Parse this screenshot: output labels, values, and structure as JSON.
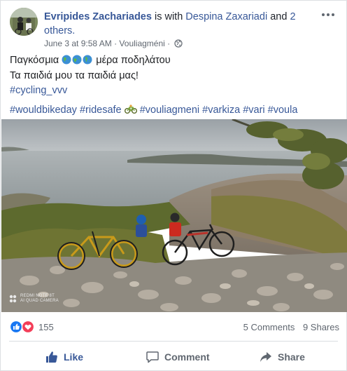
{
  "post": {
    "author": "Evripides Zachariades",
    "with_text": "is with",
    "tagged_person": "Despina Zaxariadi",
    "and_text": "and",
    "others": "2 others.",
    "date": "June 3 at 9:58 AM",
    "separator": "·",
    "location": "Vouliagméni",
    "separator2": "·",
    "privacy_icon": "globe-icon",
    "more_icon": "more-options-icon"
  },
  "text": {
    "line1_start": "Παγκόσμια",
    "line1_emoji": "globe-emoji x3",
    "line1_end": "μέρα ποδηλάτου",
    "line2": "Τα παιδιά μου τα παιδιά μας!",
    "line3": "#cycling_vvv",
    "tag1": "#wouldbikeday",
    "tag2": "#ridesafe",
    "bike_emoji": "bicycle-emoji",
    "tag3": "#vouliagmeni",
    "tag4": "#varkiza",
    "tag5": "#vari",
    "tag6": "#voula"
  },
  "photo": {
    "watermark_line1": "REDMI NOTE 8T",
    "watermark_line2": "AI QUAD CAMERA"
  },
  "reactions": {
    "icons": [
      "like-reaction-icon",
      "love-reaction-icon"
    ],
    "count": "155",
    "comments": "5 Comments",
    "shares": "9 Shares"
  },
  "actions": {
    "like": "Like",
    "comment": "Comment",
    "share": "Share"
  },
  "colors": {
    "link": "#385898",
    "meta": "#606770",
    "like_blue": "#1877f2",
    "love_red": "#f33e58"
  }
}
